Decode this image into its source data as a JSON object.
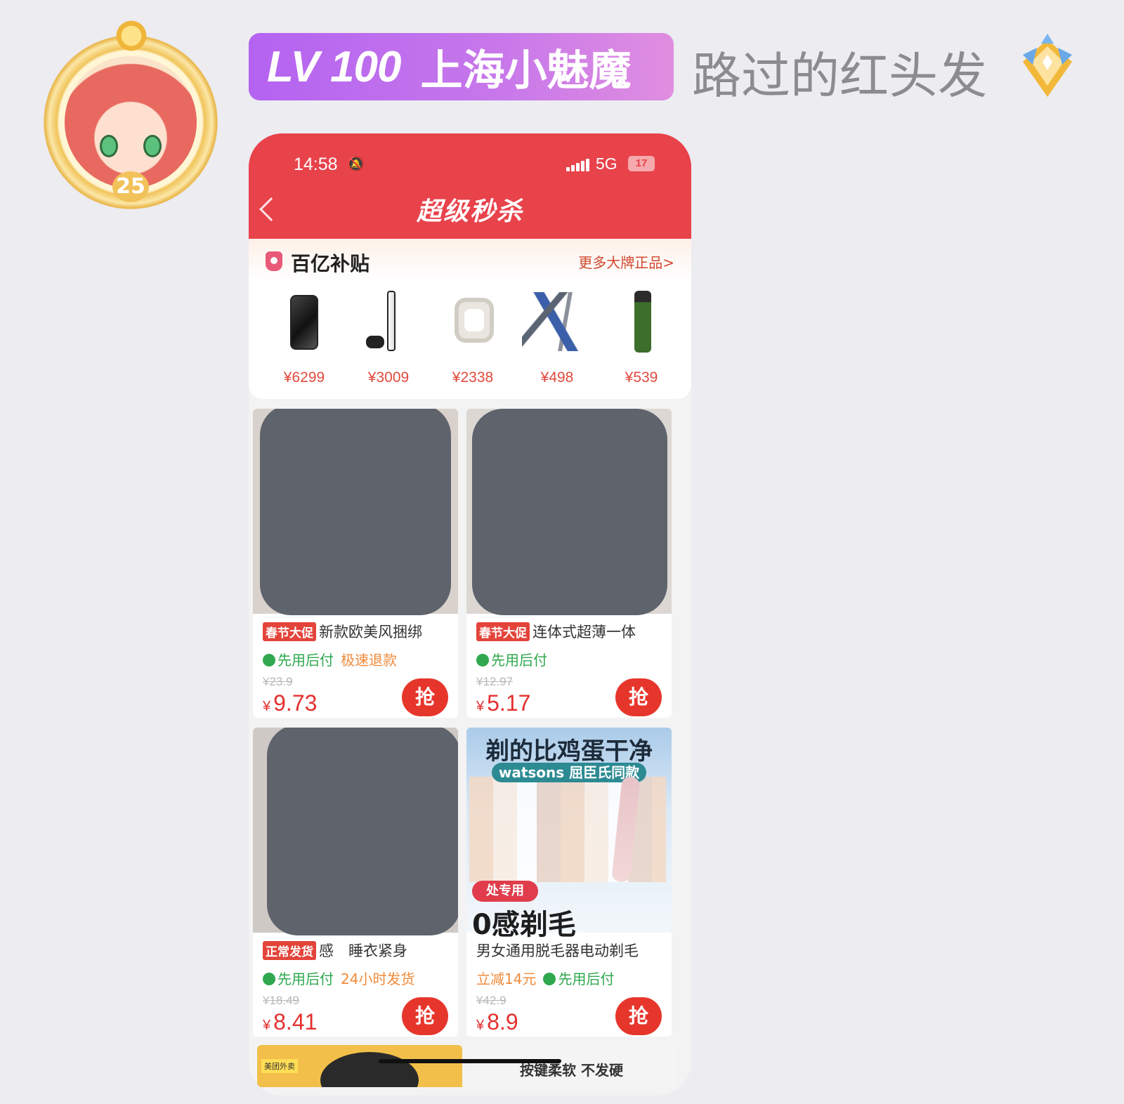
{
  "header": {
    "level": "LV 100",
    "badge_title": "上海小魅魔",
    "username": "路过的红头发",
    "avatar_badge_number": "25"
  },
  "status_bar": {
    "time": "14:58",
    "network": "5G",
    "battery": "17"
  },
  "nav": {
    "title": "超级秒杀"
  },
  "subsidy": {
    "title": "百亿补贴",
    "more_link": "更多大牌正品>",
    "products": [
      {
        "price": "¥6299",
        "icon": "phone-icon"
      },
      {
        "price": "¥3009",
        "icon": "console-icon"
      },
      {
        "price": "¥2338",
        "icon": "watch-icon"
      },
      {
        "price": "¥498",
        "icon": "model-icon"
      },
      {
        "price": "¥539",
        "icon": "bottle-icon"
      }
    ]
  },
  "items": [
    {
      "tag": "春节大促",
      "title": "新款欧美风捆绑",
      "feature": "先用后付",
      "feature2": "极速退款",
      "orig_price": "¥23.9",
      "yen": "¥",
      "price": "9.73",
      "button": "抢"
    },
    {
      "tag": "春节大促",
      "title": "连体式超薄一体",
      "feature": "先用后付",
      "feature2": "",
      "orig_price": "¥12.97",
      "yen": "¥",
      "price": "5.17",
      "button": "抢"
    },
    {
      "tag": "正常发货",
      "title": "感　睡衣紧身",
      "feature": "先用后付",
      "feature2": "24小时发货",
      "orig_price": "¥18.49",
      "yen": "¥",
      "price": "8.41",
      "button": "抢"
    },
    {
      "tag": "",
      "title": "男女通用脱毛器电动剃毛",
      "feature_prefix": "立减14元",
      "feature": "先用后付",
      "orig_price": "¥42.9",
      "yen": "¥",
      "price": "8.9",
      "button": "抢"
    }
  ],
  "promo": {
    "line1": "剃的比鸡蛋干净",
    "line2": "watsons 屈臣氏同款",
    "line3": "处专用",
    "line4": "0感剃毛"
  },
  "bottom": {
    "left_label": "美团外卖",
    "right_text": "按键柔软 不发硬"
  },
  "colors": {
    "accent_red": "#e8424b",
    "badge_purple": "#b363f0",
    "pay_green": "#2fa84f"
  }
}
